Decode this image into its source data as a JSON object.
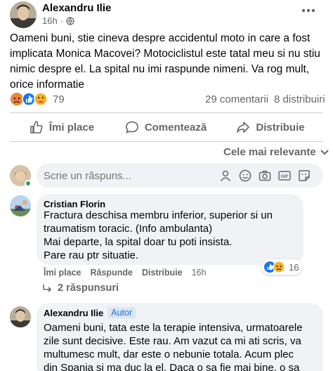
{
  "post": {
    "author": "Alexandru Ilie",
    "time": "16h",
    "body": "Oameni buni, stie cineva despre accidentul moto in care a fost implicata Monica Macovei? Motociclistul este tatal meu si nu stiu nimic despre el. La spital nu imi raspunde nimeni. Va rog mult, orice informatie",
    "reaction_count": "79",
    "comments_count": "29 comentarii",
    "shares_count": "8 distribuiri"
  },
  "actions": {
    "like": "Îmi place",
    "comment": "Comentează",
    "share": "Distribuie"
  },
  "sort": {
    "label": "Cele mai relevante"
  },
  "composer": {
    "placeholder": "Scrie un răspuns..."
  },
  "comments": [
    {
      "author": "Cristian Florin",
      "lines": [
        "Fractura deschisa membru inferior, superior si un",
        "traumatism toracic. (Info ambulanta)",
        "Mai departe, la spital doar tu poti insista.",
        "Pare rau ptr situatie."
      ],
      "like": "Îmi place",
      "reply": "Răspunde",
      "share": "Distribuie",
      "time": "16h",
      "reaction_count": "16",
      "replies": "2 răspunsuri"
    },
    {
      "author": "Alexandru Ilie",
      "badge": "Autor",
      "lines": [
        "Oameni buni, tata este la terapie intensiva, urmatoarele",
        "zile sunt decisive. Este rau. Am vazut ca mi ati scris, va",
        "multumesc mult, dar este o nebunie totala. Acum plec",
        "din Spania si ma duc la el. Daca o sa fie mai bine, o sa"
      ]
    }
  ],
  "colors": {
    "link_blue": "#216fdb",
    "like_blue": "#1877f2",
    "bubble_gray": "#f0f2f5",
    "muted_gray": "#65676b"
  }
}
